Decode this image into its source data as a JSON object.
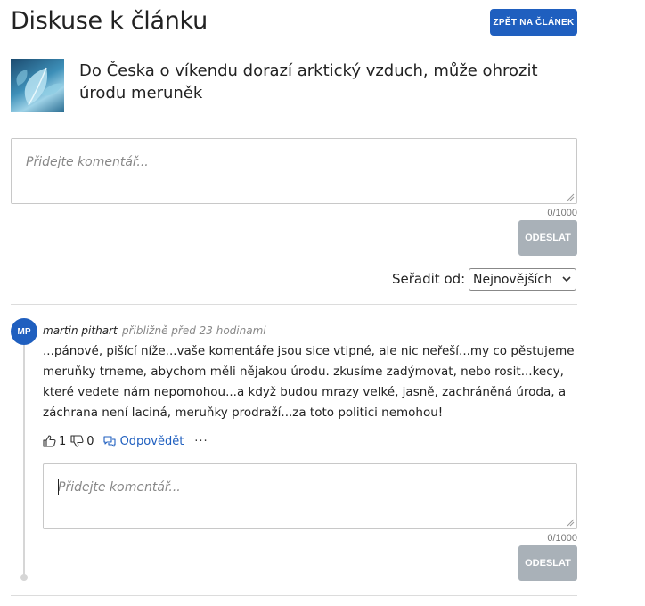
{
  "header": {
    "page_title": "Diskuse k článku",
    "back_button": "ZPĚT NA ČLÁNEK"
  },
  "article": {
    "title": "Do Česka o víkendu dorazí arktický vzduch, může ohrozit úrodu meruněk"
  },
  "composer": {
    "placeholder": "Přidejte komentář...",
    "counter": "0/1000",
    "submit_label": "ODESLAT"
  },
  "sort": {
    "label": "Seřadit od:",
    "selected": "Nejnovějších"
  },
  "comment": {
    "avatar_initials": "MP",
    "author": "martin pithart",
    "time": "přibližně před 23 hodinami",
    "body": "...pánové, pišící níže...vaše komentáře jsou sice vtipné, ale nic neřeší...my co pěstujeme meruňky trneme, abychom měli nějakou úrodu. zkusíme zadýmovat, nebo rosit...kecy, které vedete nám nepomohou...a když budou mrazy velké, jasně, zachráněná úroda, a záchrana není laciná, meruňky prodraží...za toto politici nemohou!",
    "likes": "1",
    "dislikes": "0",
    "reply_label": "Odpovědět",
    "more_label": "···"
  },
  "reply_composer": {
    "placeholder": "Přidejte komentář...",
    "counter": "0/1000",
    "submit_label": "ODESLAT"
  },
  "colors": {
    "accent": "#1f5fbf",
    "disabled_button": "#a9b1b8"
  }
}
